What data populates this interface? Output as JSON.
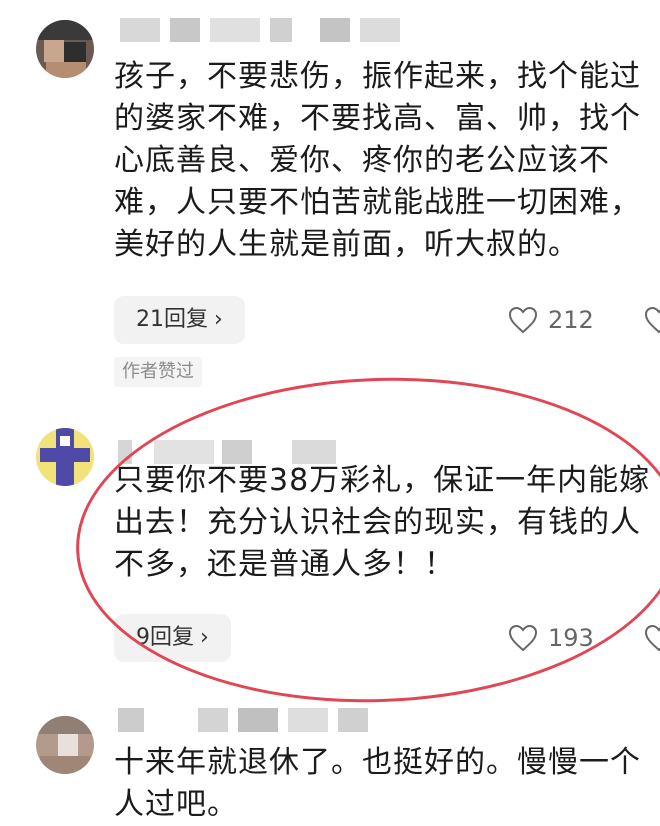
{
  "comments": [
    {
      "text": "孩子，不要悲伤，振作起来，找个能过\n的婆家不难，不要找高、富、帅，找个\n心底善良、爱你、疼你的老公应该不\n难，人只要不怕苦就能战胜一切困难，\n美好的人生就是前面，听大叔的。",
      "reply_label": "21回复",
      "likes": "212",
      "badge": "作者赞过"
    },
    {
      "text": "只要你不要38万彩礼，保证一年内能嫁\n出去！充分认识社会的现实，有钱的人\n不多，还是普通人多！！",
      "reply_label": "9回复",
      "likes": "193"
    },
    {
      "text": "十来年就退休了。也挺好的。慢慢一个\n人过吧。"
    }
  ],
  "icons": {
    "reply_chevron": "chevron-right-icon",
    "like": "heart-outline-icon"
  },
  "colors": {
    "circle_annotation": "#e24553",
    "reply_button_bg": "#f2f2f2",
    "badge_text": "#8c8c8c"
  }
}
